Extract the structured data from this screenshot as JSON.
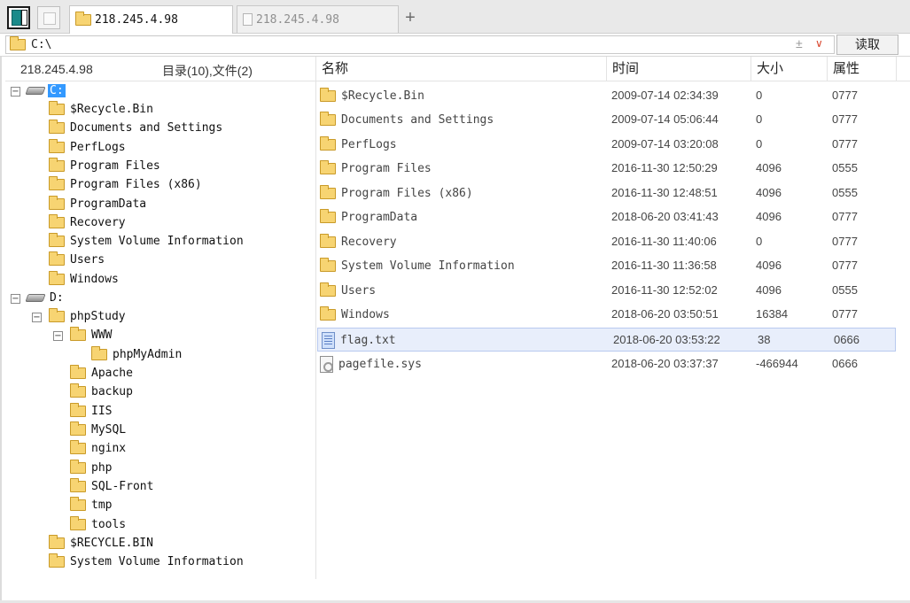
{
  "tabs": [
    {
      "label": "218.245.4.98",
      "active": true
    },
    {
      "label": "218.245.4.98",
      "active": false
    }
  ],
  "tabbar": {
    "add_tab": "+"
  },
  "address": {
    "path": "C:\\",
    "plus_minus": "±",
    "chevron": "∨",
    "read_label": "读取"
  },
  "left_header": {
    "host": "218.245.4.98",
    "summary": "目录(10),文件(2)"
  },
  "tree": [
    {
      "label": "C:",
      "type": "drive",
      "expander": "−",
      "selected": true
    },
    {
      "label": "$Recycle.Bin",
      "type": "folder"
    },
    {
      "label": "Documents and Settings",
      "type": "folder"
    },
    {
      "label": "PerfLogs",
      "type": "folder"
    },
    {
      "label": "Program Files",
      "type": "folder"
    },
    {
      "label": "Program Files (x86)",
      "type": "folder"
    },
    {
      "label": "ProgramData",
      "type": "folder"
    },
    {
      "label": "Recovery",
      "type": "folder"
    },
    {
      "label": "System Volume Information",
      "type": "folder"
    },
    {
      "label": "Users",
      "type": "folder"
    },
    {
      "label": "Windows",
      "type": "folder"
    },
    {
      "label": "D:",
      "type": "drive",
      "expander": "−"
    },
    {
      "label": "phpStudy",
      "type": "folder",
      "expander": "−"
    },
    {
      "label": "WWW",
      "type": "folder",
      "expander": "−"
    },
    {
      "label": "phpMyAdmin",
      "type": "folder"
    },
    {
      "label": "Apache",
      "type": "folder"
    },
    {
      "label": "backup",
      "type": "folder"
    },
    {
      "label": "IIS",
      "type": "folder"
    },
    {
      "label": "MySQL",
      "type": "folder"
    },
    {
      "label": "nginx",
      "type": "folder"
    },
    {
      "label": "php",
      "type": "folder"
    },
    {
      "label": "SQL-Front",
      "type": "folder"
    },
    {
      "label": "tmp",
      "type": "folder"
    },
    {
      "label": "tools",
      "type": "folder"
    },
    {
      "label": "$RECYCLE.BIN",
      "type": "folder"
    },
    {
      "label": "System Volume Information",
      "type": "folder"
    }
  ],
  "columns": {
    "name": "名称",
    "time": "时间",
    "size": "大小",
    "attr": "属性"
  },
  "files": [
    {
      "name": "$Recycle.Bin",
      "time": "2009-07-14 02:34:39",
      "size": "0",
      "attr": "0777",
      "type": "folder"
    },
    {
      "name": "Documents and Settings",
      "time": "2009-07-14 05:06:44",
      "size": "0",
      "attr": "0777",
      "type": "folder"
    },
    {
      "name": "PerfLogs",
      "time": "2009-07-14 03:20:08",
      "size": "0",
      "attr": "0777",
      "type": "folder"
    },
    {
      "name": "Program Files",
      "time": "2016-11-30 12:50:29",
      "size": "4096",
      "attr": "0555",
      "type": "folder"
    },
    {
      "name": "Program Files (x86)",
      "time": "2016-11-30 12:48:51",
      "size": "4096",
      "attr": "0555",
      "type": "folder"
    },
    {
      "name": "ProgramData",
      "time": "2018-06-20 03:41:43",
      "size": "4096",
      "attr": "0777",
      "type": "folder"
    },
    {
      "name": "Recovery",
      "time": "2016-11-30 11:40:06",
      "size": "0",
      "attr": "0777",
      "type": "folder"
    },
    {
      "name": "System Volume Information",
      "time": "2016-11-30 11:36:58",
      "size": "4096",
      "attr": "0777",
      "type": "folder"
    },
    {
      "name": "Users",
      "time": "2016-11-30 12:52:02",
      "size": "4096",
      "attr": "0555",
      "type": "folder"
    },
    {
      "name": "Windows",
      "time": "2018-06-20 03:50:51",
      "size": "16384",
      "attr": "0777",
      "type": "folder"
    },
    {
      "name": "flag.txt",
      "time": "2018-06-20 03:53:22",
      "size": "38",
      "attr": "0666",
      "type": "text-file",
      "highlighted": true
    },
    {
      "name": "pagefile.sys",
      "time": "2018-06-20 03:37:37",
      "size": "-466944",
      "attr": "0666",
      "type": "system-file"
    }
  ],
  "colors": {
    "selection": "#3399ff",
    "row_highlight": "#e8eefb",
    "folder": "#f7d472",
    "accent_chevron": "#d9452d"
  }
}
